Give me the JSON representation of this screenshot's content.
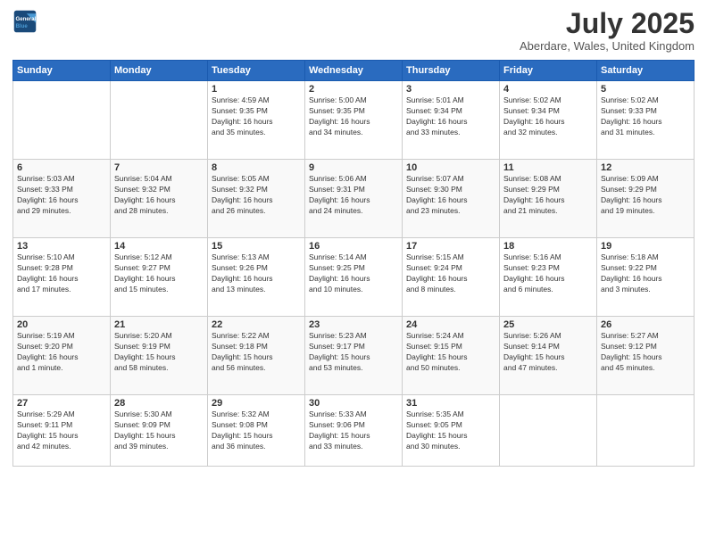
{
  "logo": {
    "line1": "General",
    "line2": "Blue"
  },
  "title": "July 2025",
  "location": "Aberdare, Wales, United Kingdom",
  "weekdays": [
    "Sunday",
    "Monday",
    "Tuesday",
    "Wednesday",
    "Thursday",
    "Friday",
    "Saturday"
  ],
  "weeks": [
    [
      {
        "day": "",
        "info": ""
      },
      {
        "day": "",
        "info": ""
      },
      {
        "day": "1",
        "info": "Sunrise: 4:59 AM\nSunset: 9:35 PM\nDaylight: 16 hours\nand 35 minutes."
      },
      {
        "day": "2",
        "info": "Sunrise: 5:00 AM\nSunset: 9:35 PM\nDaylight: 16 hours\nand 34 minutes."
      },
      {
        "day": "3",
        "info": "Sunrise: 5:01 AM\nSunset: 9:34 PM\nDaylight: 16 hours\nand 33 minutes."
      },
      {
        "day": "4",
        "info": "Sunrise: 5:02 AM\nSunset: 9:34 PM\nDaylight: 16 hours\nand 32 minutes."
      },
      {
        "day": "5",
        "info": "Sunrise: 5:02 AM\nSunset: 9:33 PM\nDaylight: 16 hours\nand 31 minutes."
      }
    ],
    [
      {
        "day": "6",
        "info": "Sunrise: 5:03 AM\nSunset: 9:33 PM\nDaylight: 16 hours\nand 29 minutes."
      },
      {
        "day": "7",
        "info": "Sunrise: 5:04 AM\nSunset: 9:32 PM\nDaylight: 16 hours\nand 28 minutes."
      },
      {
        "day": "8",
        "info": "Sunrise: 5:05 AM\nSunset: 9:32 PM\nDaylight: 16 hours\nand 26 minutes."
      },
      {
        "day": "9",
        "info": "Sunrise: 5:06 AM\nSunset: 9:31 PM\nDaylight: 16 hours\nand 24 minutes."
      },
      {
        "day": "10",
        "info": "Sunrise: 5:07 AM\nSunset: 9:30 PM\nDaylight: 16 hours\nand 23 minutes."
      },
      {
        "day": "11",
        "info": "Sunrise: 5:08 AM\nSunset: 9:29 PM\nDaylight: 16 hours\nand 21 minutes."
      },
      {
        "day": "12",
        "info": "Sunrise: 5:09 AM\nSunset: 9:29 PM\nDaylight: 16 hours\nand 19 minutes."
      }
    ],
    [
      {
        "day": "13",
        "info": "Sunrise: 5:10 AM\nSunset: 9:28 PM\nDaylight: 16 hours\nand 17 minutes."
      },
      {
        "day": "14",
        "info": "Sunrise: 5:12 AM\nSunset: 9:27 PM\nDaylight: 16 hours\nand 15 minutes."
      },
      {
        "day": "15",
        "info": "Sunrise: 5:13 AM\nSunset: 9:26 PM\nDaylight: 16 hours\nand 13 minutes."
      },
      {
        "day": "16",
        "info": "Sunrise: 5:14 AM\nSunset: 9:25 PM\nDaylight: 16 hours\nand 10 minutes."
      },
      {
        "day": "17",
        "info": "Sunrise: 5:15 AM\nSunset: 9:24 PM\nDaylight: 16 hours\nand 8 minutes."
      },
      {
        "day": "18",
        "info": "Sunrise: 5:16 AM\nSunset: 9:23 PM\nDaylight: 16 hours\nand 6 minutes."
      },
      {
        "day": "19",
        "info": "Sunrise: 5:18 AM\nSunset: 9:22 PM\nDaylight: 16 hours\nand 3 minutes."
      }
    ],
    [
      {
        "day": "20",
        "info": "Sunrise: 5:19 AM\nSunset: 9:20 PM\nDaylight: 16 hours\nand 1 minute."
      },
      {
        "day": "21",
        "info": "Sunrise: 5:20 AM\nSunset: 9:19 PM\nDaylight: 15 hours\nand 58 minutes."
      },
      {
        "day": "22",
        "info": "Sunrise: 5:22 AM\nSunset: 9:18 PM\nDaylight: 15 hours\nand 56 minutes."
      },
      {
        "day": "23",
        "info": "Sunrise: 5:23 AM\nSunset: 9:17 PM\nDaylight: 15 hours\nand 53 minutes."
      },
      {
        "day": "24",
        "info": "Sunrise: 5:24 AM\nSunset: 9:15 PM\nDaylight: 15 hours\nand 50 minutes."
      },
      {
        "day": "25",
        "info": "Sunrise: 5:26 AM\nSunset: 9:14 PM\nDaylight: 15 hours\nand 47 minutes."
      },
      {
        "day": "26",
        "info": "Sunrise: 5:27 AM\nSunset: 9:12 PM\nDaylight: 15 hours\nand 45 minutes."
      }
    ],
    [
      {
        "day": "27",
        "info": "Sunrise: 5:29 AM\nSunset: 9:11 PM\nDaylight: 15 hours\nand 42 minutes."
      },
      {
        "day": "28",
        "info": "Sunrise: 5:30 AM\nSunset: 9:09 PM\nDaylight: 15 hours\nand 39 minutes."
      },
      {
        "day": "29",
        "info": "Sunrise: 5:32 AM\nSunset: 9:08 PM\nDaylight: 15 hours\nand 36 minutes."
      },
      {
        "day": "30",
        "info": "Sunrise: 5:33 AM\nSunset: 9:06 PM\nDaylight: 15 hours\nand 33 minutes."
      },
      {
        "day": "31",
        "info": "Sunrise: 5:35 AM\nSunset: 9:05 PM\nDaylight: 15 hours\nand 30 minutes."
      },
      {
        "day": "",
        "info": ""
      },
      {
        "day": "",
        "info": ""
      }
    ]
  ]
}
